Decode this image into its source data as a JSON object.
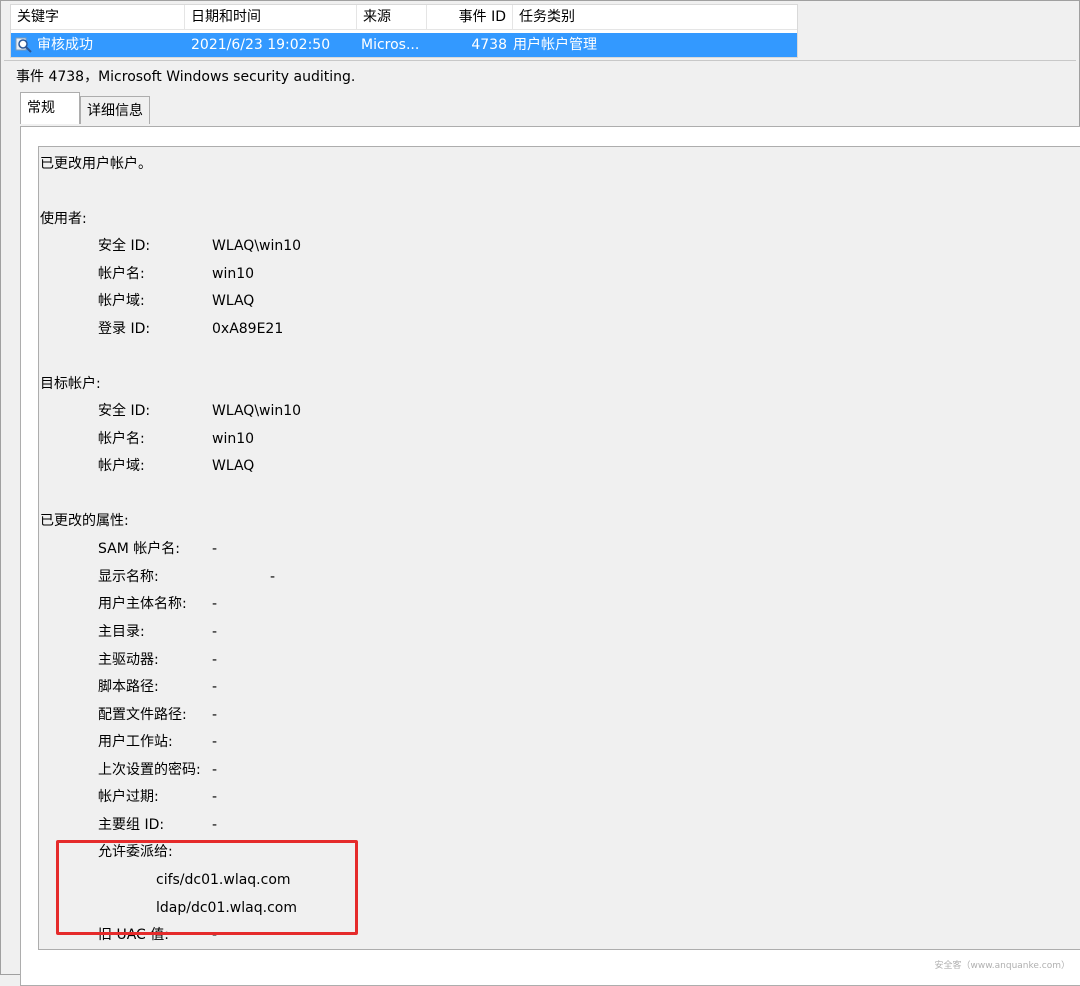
{
  "list": {
    "columns": [
      "关键字",
      "日期和时间",
      "来源",
      "事件 ID",
      "任务类别"
    ],
    "row": {
      "keyword": "审核成功",
      "datetime": "2021/6/23 19:02:50",
      "source": "Micros...",
      "event_id": "4738",
      "category": "用户帐户管理",
      "icon": "key-search-icon"
    },
    "selection_color": "#3399ff"
  },
  "event": {
    "title": "事件 4738，Microsoft Windows security auditing.",
    "tabs": [
      "常规",
      "详细信息"
    ],
    "active_tab": "常规"
  },
  "body": {
    "intro": "已更改用户帐户。",
    "subject": {
      "heading": "使用者:",
      "fields": [
        {
          "label": "安全 ID:",
          "value": "WLAQ\\win10"
        },
        {
          "label": "帐户名:",
          "value": "win10"
        },
        {
          "label": "帐户域:",
          "value": "WLAQ"
        },
        {
          "label": "登录 ID:",
          "value": "0xA89E21"
        }
      ]
    },
    "target": {
      "heading": "目标帐户:",
      "fields": [
        {
          "label": "安全 ID:",
          "value": "WLAQ\\win10"
        },
        {
          "label": "帐户名:",
          "value": "win10"
        },
        {
          "label": "帐户域:",
          "value": "WLAQ"
        }
      ]
    },
    "changed": {
      "heading": "已更改的属性:",
      "fields": [
        {
          "label": "SAM 帐户名:",
          "value": "-"
        },
        {
          "label": "显示名称:",
          "value": "-"
        },
        {
          "label": "用户主体名称:",
          "value": "-"
        },
        {
          "label": "主目录:",
          "value": "-"
        },
        {
          "label": "主驱动器:",
          "value": "-"
        },
        {
          "label": "脚本路径:",
          "value": "-"
        },
        {
          "label": "配置文件路径:",
          "value": "-"
        },
        {
          "label": "用户工作站:",
          "value": "-"
        },
        {
          "label": "上次设置的密码:",
          "value": "-"
        },
        {
          "label": "帐户过期:",
          "value": "-"
        },
        {
          "label": "主要组 ID:",
          "value": "-"
        }
      ],
      "delegation_label": "允许委派给:",
      "delegation_values": [
        "cifs/dc01.wlaq.com",
        "ldap/dc01.wlaq.com"
      ],
      "old_uac_label": "旧 UAC 值:",
      "old_uac_value": "-"
    }
  },
  "highlight_color": "#e52b2b",
  "watermark": "安全客（www.anquanke.com）"
}
